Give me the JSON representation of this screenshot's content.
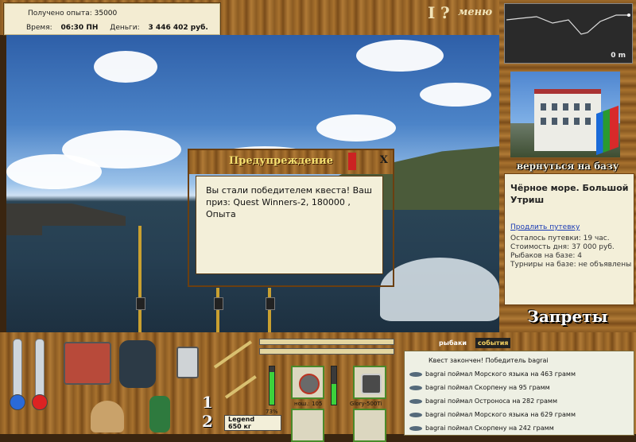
{
  "stats": {
    "experience_label": "Получено опыта:",
    "experience_value": "35000",
    "time_label": "Время:",
    "time_value": "06:30 ПН",
    "money_label": "Деньги:",
    "money_value": "3 446 402 руб."
  },
  "top_menu": {
    "info_glyph": "I",
    "help_glyph": "?",
    "menu_label": "меню"
  },
  "depth": {
    "value": "0 m"
  },
  "dialog": {
    "title": "Предупреждение",
    "close": "X",
    "message": "Вы стали победителем квеста! Ваш приз: Quest Winners-2, 180000 , Опыта"
  },
  "base": {
    "return_button": "вернуться на базу",
    "name": "Чёрное море. Большой Утриш",
    "extend_link": "Продлить путевку",
    "info": [
      "Осталось путевки: 19 час.",
      "Стоимость дня: 37 000 руб.",
      "Рыбаков на базе: 4",
      "Турниры на базе: не объявлены"
    ],
    "bans_button": "Запреты"
  },
  "gear": {
    "slot1_number": "1",
    "slot2_number": "2",
    "rod_percent": "73%",
    "reel_label": "нош.: 105",
    "line_label": "Glory-500Ti",
    "line_weight_name": "Legend",
    "line_weight_value": "650 кг",
    "reel_level": 0.7,
    "line_level": 0.55,
    "rod_level": 0.85
  },
  "events": {
    "tab_fishers": "рыбаки",
    "tab_events": "события",
    "rows": [
      "Квест закончен! Победитель bagrai",
      "bagrai поймал Морского языка на 463 грамм",
      "bagrai поймал Скорпену на 95 грамм",
      "bagrai поймал Остроноса на 282 грамм",
      "bagrai поймал Морского языка на 629 грамм",
      "bagrai поймал Скорпену на 242 грамм"
    ]
  },
  "colors": {
    "accent_gold": "#f5e070",
    "link": "#1a3ab4",
    "gauge_green": "#3cd23c"
  }
}
